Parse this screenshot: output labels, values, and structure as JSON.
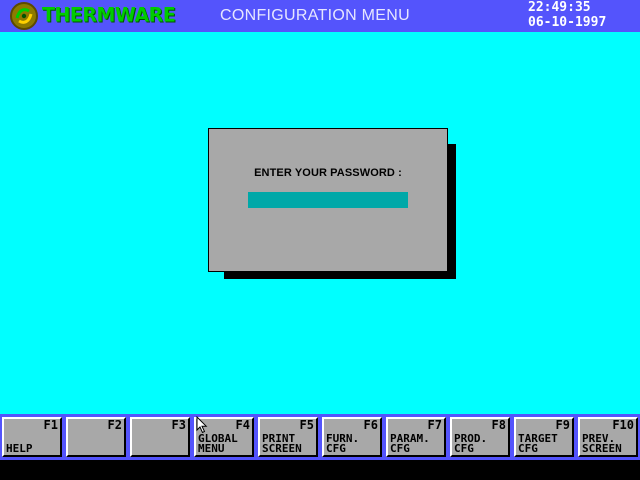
{
  "header": {
    "logo_text": "THERMWARE",
    "title": "CONFIGURATION MENU",
    "time": "22:49:35",
    "date": "06-10-1997"
  },
  "dialog": {
    "prompt": "ENTER YOUR PASSWORD :",
    "password_value": ""
  },
  "function_keys": [
    {
      "key": "F1",
      "label": "HELP"
    },
    {
      "key": "F2",
      "label": ""
    },
    {
      "key": "F3",
      "label": ""
    },
    {
      "key": "F4",
      "label": "GLOBAL\nMENU"
    },
    {
      "key": "F5",
      "label": "PRINT\nSCREEN"
    },
    {
      "key": "F6",
      "label": "FURN.\nCFG"
    },
    {
      "key": "F7",
      "label": "PARAM.\nCFG"
    },
    {
      "key": "F8",
      "label": "PROD.\nCFG"
    },
    {
      "key": "F9",
      "label": "TARGET\nCFG"
    },
    {
      "key": "F10",
      "label": "PREV.\nSCREEN"
    }
  ],
  "colors": {
    "desktop": "#00FFFF",
    "bar": "#5454FC",
    "dialog": "#A8A8A8",
    "input": "#00A8A8",
    "logo_text": "#00CC00"
  },
  "icons": {
    "logo": "thermware-logo-icon",
    "pointer": "mouse-pointer-icon"
  }
}
